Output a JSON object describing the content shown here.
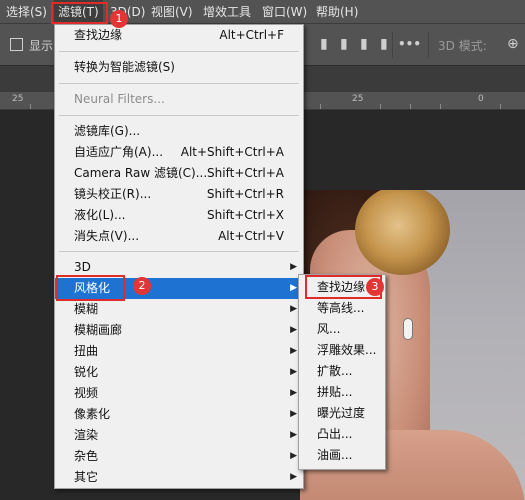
{
  "menubar": {
    "items": [
      {
        "label": "选择(S)"
      },
      {
        "label": "滤镜(T)"
      },
      {
        "label": "3D(D)"
      },
      {
        "label": "视图(V)"
      },
      {
        "label": "增效工具"
      },
      {
        "label": "窗口(W)"
      },
      {
        "label": "帮助(H)"
      }
    ]
  },
  "options": {
    "show_label": "显示",
    "more_icon": "•••",
    "mode_label": "3D 模式:"
  },
  "ruler": {
    "labels": [
      "25",
      "25",
      "0"
    ]
  },
  "filter_menu": {
    "items": [
      {
        "label": "查找边缘",
        "shortcut": "Alt+Ctrl+F"
      },
      {
        "label": "转换为智能滤镜(S)",
        "shortcut": ""
      },
      {
        "label": "Neural Filters...",
        "shortcut": ""
      },
      {
        "label": "滤镜库(G)...",
        "shortcut": ""
      },
      {
        "label": "自适应广角(A)...",
        "shortcut": "Alt+Shift+Ctrl+A"
      },
      {
        "label": "Camera Raw 滤镜(C)...",
        "shortcut": "Shift+Ctrl+A"
      },
      {
        "label": "镜头校正(R)...",
        "shortcut": "Shift+Ctrl+R"
      },
      {
        "label": "液化(L)...",
        "shortcut": "Shift+Ctrl+X"
      },
      {
        "label": "消失点(V)...",
        "shortcut": "Alt+Ctrl+V"
      },
      {
        "label": "3D",
        "shortcut": ""
      },
      {
        "label": "风格化",
        "shortcut": ""
      },
      {
        "label": "模糊",
        "shortcut": ""
      },
      {
        "label": "模糊画廊",
        "shortcut": ""
      },
      {
        "label": "扭曲",
        "shortcut": ""
      },
      {
        "label": "锐化",
        "shortcut": ""
      },
      {
        "label": "视频",
        "shortcut": ""
      },
      {
        "label": "像素化",
        "shortcut": ""
      },
      {
        "label": "渲染",
        "shortcut": ""
      },
      {
        "label": "杂色",
        "shortcut": ""
      },
      {
        "label": "其它",
        "shortcut": ""
      }
    ]
  },
  "stylize_submenu": {
    "items": [
      {
        "label": "查找边缘"
      },
      {
        "label": "等高线..."
      },
      {
        "label": "风..."
      },
      {
        "label": "浮雕效果..."
      },
      {
        "label": "扩散..."
      },
      {
        "label": "拼贴..."
      },
      {
        "label": "曝光过度"
      },
      {
        "label": "凸出..."
      },
      {
        "label": "油画..."
      }
    ]
  },
  "annotations": {
    "badges": [
      "1",
      "2",
      "3"
    ],
    "color": "#e02b2b"
  },
  "colors": {
    "highlight": "#1e73d2",
    "menu_bg": "#f0f0f0",
    "app_bg": "#535353"
  }
}
